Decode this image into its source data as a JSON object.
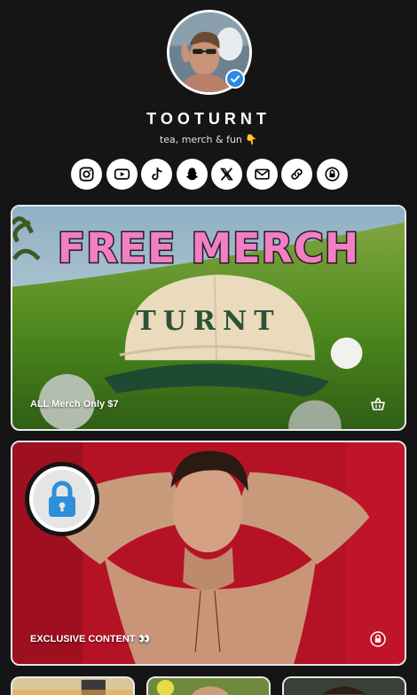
{
  "profile": {
    "name": "TOOTURNT",
    "bio": "tea, merch & fun 👇",
    "verified": true
  },
  "socials": [
    {
      "icon": "instagram-icon"
    },
    {
      "icon": "youtube-icon"
    },
    {
      "icon": "tiktok-icon"
    },
    {
      "icon": "snapchat-icon"
    },
    {
      "icon": "x-icon"
    },
    {
      "icon": "email-icon"
    },
    {
      "icon": "link-icon"
    },
    {
      "icon": "lock-icon"
    }
  ],
  "cards": [
    {
      "image_text": "FREE MERCH",
      "hat_text": "TURNT",
      "label": "ALL Merch Only $7",
      "icon": "basket-icon"
    },
    {
      "label": "EXCLUSIVE CONTENT 👀",
      "icon": "lock-icon",
      "badge_icon": "padlock-icon"
    }
  ],
  "colors": {
    "background": "#151515",
    "accent_pink": "#f07fc4",
    "verified_blue": "#2c89e3",
    "card_red": "#b51226"
  }
}
